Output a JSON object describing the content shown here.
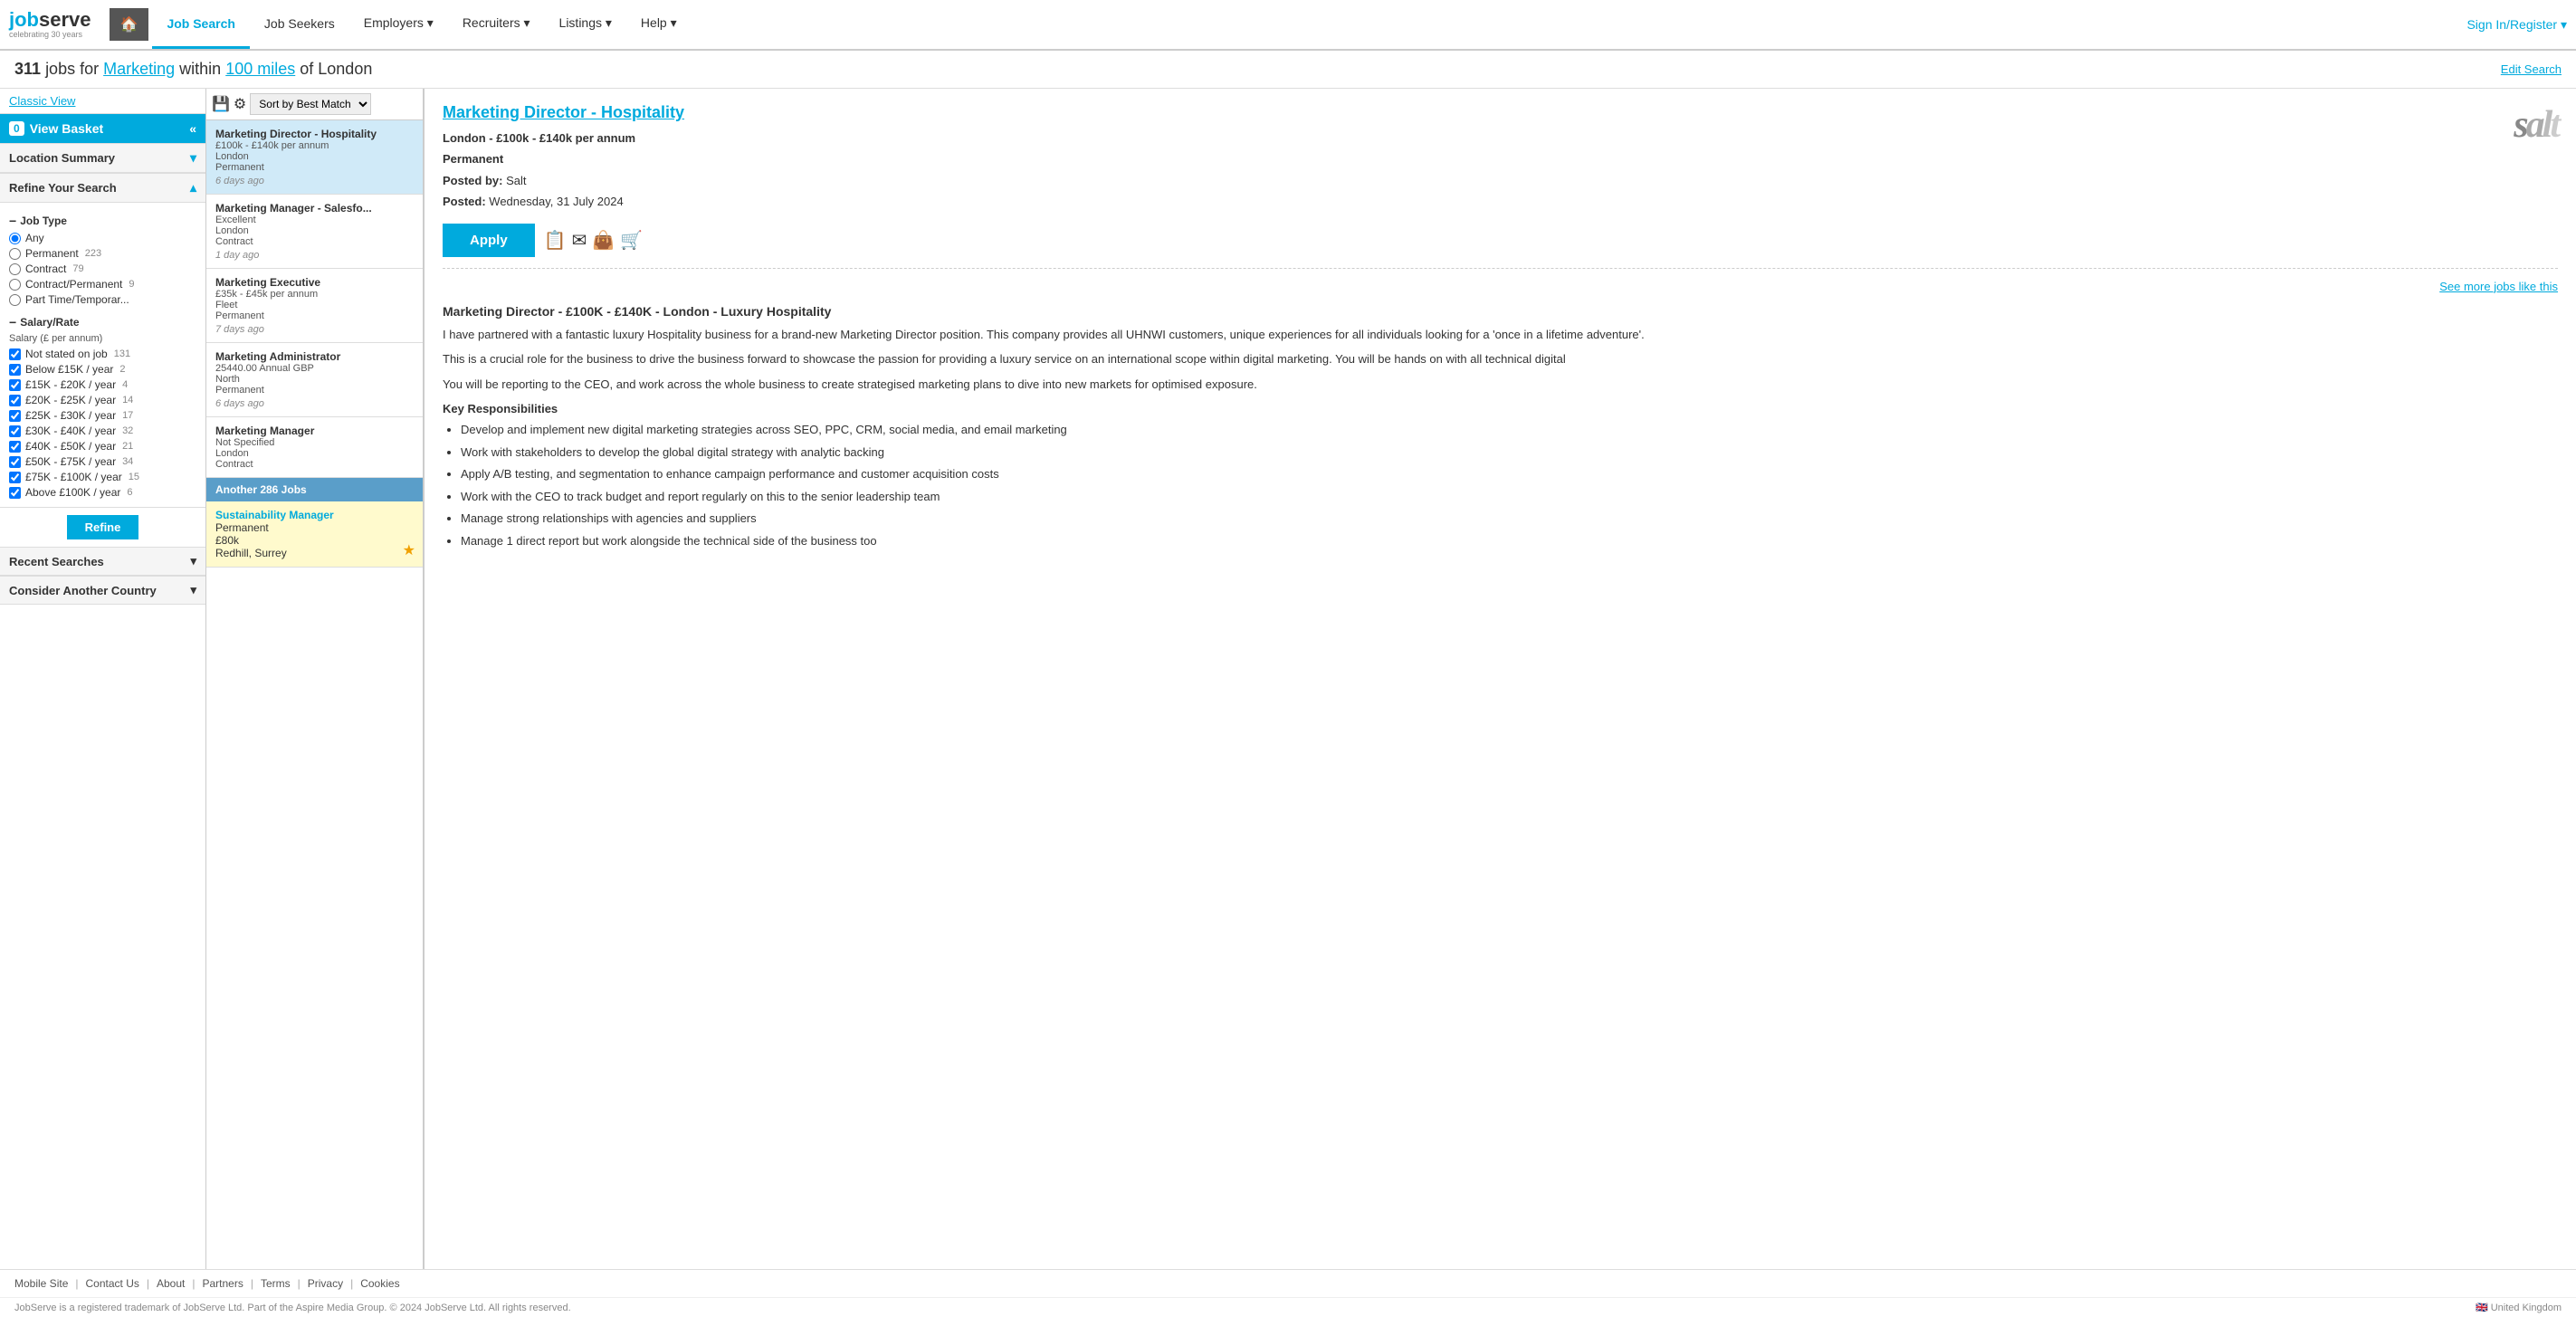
{
  "site": {
    "name": "jobserve",
    "tagline": "celebrating 30 years"
  },
  "nav": {
    "home_icon": "🏠",
    "tabs": [
      {
        "label": "Job Search",
        "active": true,
        "has_caret": false
      },
      {
        "label": "Job Seekers",
        "active": false,
        "has_caret": false
      },
      {
        "label": "Employers",
        "active": false,
        "has_caret": true
      },
      {
        "label": "Recruiters",
        "active": false,
        "has_caret": true
      },
      {
        "label": "Listings",
        "active": false,
        "has_caret": true
      },
      {
        "label": "Help",
        "active": false,
        "has_caret": true
      }
    ],
    "sign_in": "Sign In/Register ▾"
  },
  "search_header": {
    "count": "311",
    "jobs_for": "jobs for",
    "keyword": "Marketing",
    "within": "within",
    "miles": "100 miles",
    "location": "of London",
    "edit_search": "Edit Search"
  },
  "sidebar": {
    "classic_view": "Classic View",
    "view_basket": {
      "label": "View Basket",
      "count": "0",
      "icon": "«"
    },
    "location_summary": {
      "label": "Location Summary",
      "arrow": "▾"
    },
    "refine_search": {
      "label": "Refine Your Search",
      "arrow": "▴"
    },
    "job_type": {
      "label": "Job Type",
      "options": [
        {
          "label": "Any",
          "type": "radio",
          "checked": true,
          "count": ""
        },
        {
          "label": "Permanent",
          "type": "radio",
          "checked": false,
          "count": "223"
        },
        {
          "label": "Contract",
          "type": "radio",
          "checked": false,
          "count": "79"
        },
        {
          "label": "Contract/Permanent",
          "type": "radio",
          "checked": false,
          "count": "9"
        },
        {
          "label": "Part Time/Temporar...",
          "type": "radio",
          "checked": false,
          "count": ""
        }
      ]
    },
    "salary_rate": {
      "label": "Salary/Rate",
      "sublabel": "Salary (£ per annum)",
      "options": [
        {
          "label": "Not stated on job",
          "checked": true,
          "count": "131"
        },
        {
          "label": "Below £15K / year",
          "checked": true,
          "count": "2"
        },
        {
          "label": "£15K - £20K / year",
          "checked": true,
          "count": "4"
        },
        {
          "label": "£20K - £25K / year",
          "checked": true,
          "count": "14"
        },
        {
          "label": "£25K - £30K / year",
          "checked": true,
          "count": "17"
        },
        {
          "label": "£30K - £40K / year",
          "checked": true,
          "count": "32"
        },
        {
          "label": "£40K - £50K / year",
          "checked": true,
          "count": "21"
        },
        {
          "label": "£50K - £75K / year",
          "checked": true,
          "count": "34"
        },
        {
          "label": "£75K - £100K / year",
          "checked": true,
          "count": "15"
        },
        {
          "label": "Above £100K / year",
          "checked": true,
          "count": "6"
        }
      ]
    },
    "refine_button": "Refine",
    "recent_searches": {
      "label": "Recent Searches",
      "arrow": "▾"
    },
    "consider_country": {
      "label": "Consider Another Country",
      "arrow": "▾"
    }
  },
  "job_list": {
    "sort_label": "Sort by Best Match",
    "jobs": [
      {
        "title": "Marketing Director - Hospitality",
        "salary": "£100k - £140k per annum",
        "location": "London",
        "type": "Permanent",
        "age": "6 days ago",
        "selected": true,
        "featured": false
      },
      {
        "title": "Marketing Manager - Salesfo...",
        "salary": "Excellent",
        "location": "London",
        "type": "Contract",
        "age": "1 day ago",
        "selected": false,
        "featured": false
      },
      {
        "title": "Marketing Executive",
        "salary": "£35k - £45k per annum",
        "location": "Fleet",
        "type": "Permanent",
        "age": "7 days ago",
        "selected": false,
        "featured": false
      },
      {
        "title": "Marketing Administrator",
        "salary": "25440.00 Annual GBP",
        "location": "North",
        "type": "Permanent",
        "age": "6 days ago",
        "selected": false,
        "featured": false
      },
      {
        "title": "Marketing Manager",
        "salary": "Not Specified",
        "location": "London",
        "type": "Contract",
        "age": "",
        "selected": false,
        "featured": false
      }
    ],
    "another_jobs_bar": "Another 286 Jobs",
    "featured_job": {
      "title": "Sustainability Manager",
      "type": "Permanent",
      "salary": "£80k",
      "location": "Redhill, Surrey",
      "has_star": true
    }
  },
  "job_detail": {
    "title": "Marketing Director - Hospitality",
    "location": "London - £100k - £140k per annum",
    "type": "Permanent",
    "posted_by_label": "Posted by:",
    "posted_by": "Salt",
    "posted_label": "Posted:",
    "posted_date": "Wednesday, 31 July 2024",
    "apply_btn": "Apply",
    "see_more": "See more jobs like this",
    "company": "salt",
    "description_title": "Marketing Director - £100K - £140K - London - Luxury Hospitality",
    "paragraphs": [
      "I have partnered with a fantastic luxury Hospitality business for a brand-new Marketing Director position. This company provides all UHNWI customers, unique experiences for all individuals looking for a 'once in a lifetime adventure'.",
      "This is a crucial role for the business to drive the business forward to showcase the passion for providing a luxury service on an international scope within digital marketing. You will be hands on with all technical digital",
      "You will be reporting to the CEO, and work across the whole business to create strategised marketing plans to dive into new markets for optimised exposure."
    ],
    "key_responsibilities": "Key Responsibilities",
    "responsibilities": [
      "Develop and implement new digital marketing strategies across SEO, PPC, CRM, social media, and email marketing",
      "Work with stakeholders to develop the global digital strategy with analytic backing",
      "Apply A/B testing, and segmentation to enhance campaign performance and customer acquisition costs",
      "Work with the CEO to track budget and report regularly on this to the senior leadership team",
      "Manage strong relationships with agencies and suppliers",
      "Manage 1 direct report but work alongside the technical side of the business too"
    ]
  },
  "footer": {
    "links": [
      "Mobile Site",
      "Contact Us",
      "About",
      "Partners",
      "Terms",
      "Privacy",
      "Cookies"
    ],
    "copyright": "JobServe is a registered trademark of JobServe Ltd. Part of the Aspire Media Group. © 2024 JobServe Ltd. All rights reserved.",
    "region": "United Kingdom"
  }
}
